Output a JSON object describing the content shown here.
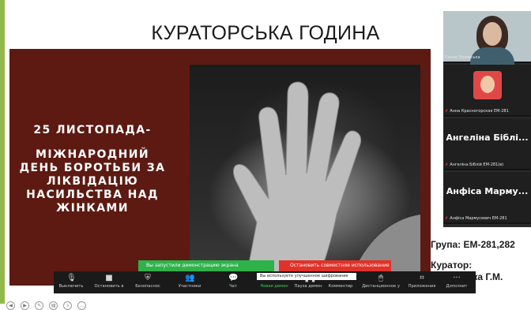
{
  "slide": {
    "title": "КУРАТОРСЬКА ГОДИНА",
    "line1": "25 ЛИСТОПАДА-",
    "line2": "МІЖНАРОДНИЙ ДЕНЬ БОРОТЬБИ ЗА ЛІКВІДАЦІЮ НАСИЛЬСТВА НАД ЖІНКАМИ"
  },
  "participants": [
    {
      "name": "Ганна Лозовська",
      "display": ""
    },
    {
      "name": "Анна Красногорская ЕМ-281",
      "display": ""
    },
    {
      "name": "Ангеліна Біблій ЕМ-281(в)",
      "display": "Ангеліна Біблі..."
    },
    {
      "name": "Анфіса Мармусевич ЕМ-281",
      "display": "Анфіса Марму..."
    }
  ],
  "side_text": {
    "group": "Група: ЕМ-281,282",
    "curator_label": "Куратор:",
    "curator_name": "ька Г.М."
  },
  "share": {
    "status": "Вы запустили демонстрацию экрана",
    "stop": "Остановить совместное использование",
    "tooltip": "Вы используете улучшенное шифрование"
  },
  "toolbar": {
    "items": [
      {
        "label": "Выключить",
        "icon": "microphone-icon"
      },
      {
        "label": "Остановить в",
        "icon": "video-camera-icon"
      },
      {
        "label": "Безопаснос",
        "icon": "shield-icon"
      },
      {
        "label": "Участники",
        "icon": "participants-icon",
        "count": "16"
      },
      {
        "label": "Чат",
        "icon": "chat-icon"
      },
      {
        "label": "Новая демон",
        "icon": "share-screen-icon"
      },
      {
        "label": "Пауза демон",
        "icon": "pause-icon"
      },
      {
        "label": "Комментир",
        "icon": "annotate-icon"
      },
      {
        "label": "Дистанционное у",
        "icon": "remote-control-icon"
      },
      {
        "label": "Приложения",
        "icon": "apps-icon"
      },
      {
        "label": "Дополнит",
        "icon": "more-icon"
      }
    ]
  },
  "colors": {
    "slide_bg": "#5c1a12",
    "slide_border": "#93b84a",
    "share_green": "#2fb24a",
    "stop_red": "#e0322a",
    "toolbar_bg": "#1a1a1a"
  }
}
